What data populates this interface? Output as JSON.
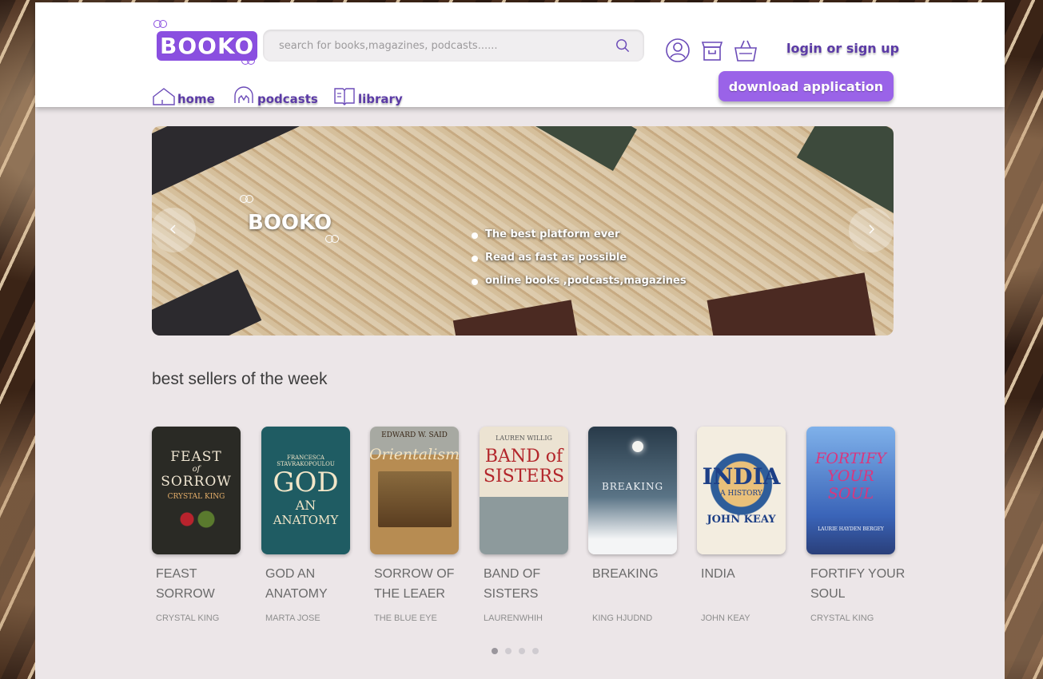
{
  "brand": {
    "name": "BOOKO",
    "accent": "#8a4fe0"
  },
  "search": {
    "placeholder": "search for books,magazines, podcasts......",
    "icon": "search-icon"
  },
  "header": {
    "icons": [
      "user-icon",
      "shop-icon",
      "basket-icon"
    ],
    "login_label": "login or sign up",
    "download_label": "download application"
  },
  "nav": [
    {
      "label": "home",
      "icon": "home-icon"
    },
    {
      "label": "podcasts",
      "icon": "headphones-icon"
    },
    {
      "label": "library",
      "icon": "book-icon"
    }
  ],
  "banner": {
    "logo_text": "BOOKO",
    "bullets": [
      "The best platform ever",
      "Read as fast as  possible",
      "online books ,podcasts,magazines"
    ]
  },
  "best_sellers": {
    "title": "best sellers of the week",
    "books": [
      {
        "title": "FEAST SORROW",
        "author": "CRYSTAL KING",
        "cover_lines": [
          "FEAST",
          "of",
          "SORROW",
          "CRYSTAL KING"
        ],
        "cover_color": "#2a2a25"
      },
      {
        "title": "GOD AN ANATOMY",
        "author": "MARTA JOSE",
        "cover_lines": [
          "FRANCESCA STAVRAKOPOULOU",
          "GOD",
          "AN",
          "ANATOMY"
        ],
        "cover_color": "#1f5c63"
      },
      {
        "title": "SORROW OF THE LEAER",
        "author": "THE BLUE EYE",
        "cover_lines": [
          "EDWARD W. SAID",
          "Orientalism"
        ],
        "cover_color": "#8a6b3e"
      },
      {
        "title": "BAND OF SISTERS",
        "author": "LAURENWHIH",
        "cover_lines": [
          "LAUREN WILLIG",
          "BAND of",
          "SISTERS"
        ],
        "cover_color": "#ece3d2"
      },
      {
        "title": "BREAKING",
        "author": "KING HJUDND",
        "cover_lines": [
          "BREAKING"
        ],
        "cover_color": "#34495a"
      },
      {
        "title": "INDIA",
        "author": "JOHN KEAY",
        "cover_lines": [
          "INDIA",
          "A HISTORY",
          "JOHN KEAY"
        ],
        "cover_color": "#f3ede0"
      },
      {
        "title": "FORTIFY YOUR SOUL",
        "author": "CRYSTAL KING",
        "cover_lines": [
          "FORTIFY",
          "YOUR",
          "SOUL",
          "LAURIE HAYDEN BERGEY"
        ],
        "cover_color": "#5a8bd6"
      }
    ]
  },
  "pagination": {
    "count": 4,
    "active": 0
  }
}
